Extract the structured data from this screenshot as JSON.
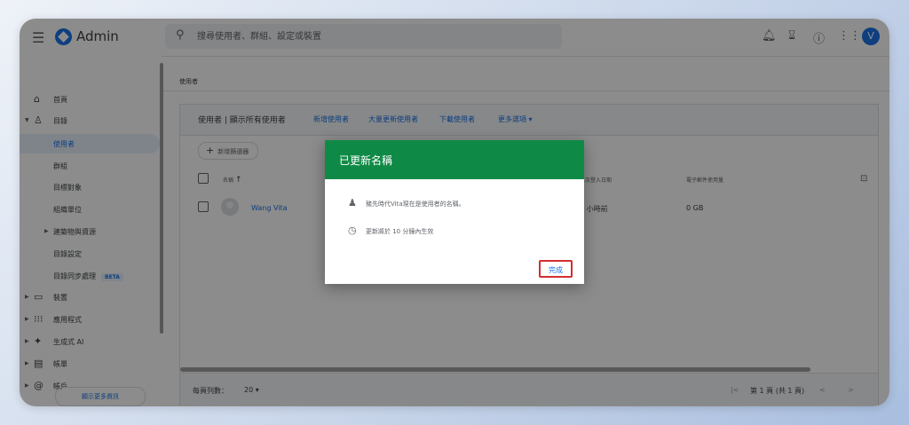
{
  "header": {
    "brand": "Admin",
    "search_placeholder": "搜尋使用者、群組、設定或裝置",
    "avatar_letter": "V"
  },
  "sidebar": {
    "items": [
      {
        "label": "首頁"
      },
      {
        "label": "目錄"
      },
      {
        "label": "使用者"
      },
      {
        "label": "群組"
      },
      {
        "label": "目標對象"
      },
      {
        "label": "組織單位"
      },
      {
        "label": "建築物與資源"
      },
      {
        "label": "目錄設定"
      },
      {
        "label": "目錄同步處理",
        "badge": "BETA"
      },
      {
        "label": "裝置"
      },
      {
        "label": "應用程式"
      },
      {
        "label": "生成式 AI"
      },
      {
        "label": "帳單"
      },
      {
        "label": "帳戶"
      }
    ],
    "more_button": "顯示更多資訊"
  },
  "main": {
    "breadcrumb": "使用者",
    "card_title": "使用者 | 顯示所有使用者",
    "actions": [
      "新增使用者",
      "大量更新使用者",
      "下載使用者",
      "更多選項"
    ],
    "add_filter": "新增篩選器",
    "columns": {
      "name": "名稱",
      "last_login": "上次登入日期",
      "email_usage": "電子郵件使用量"
    },
    "row": {
      "name": "Wang Vita",
      "last_login": "1 小時前",
      "email_usage": "0 GB"
    },
    "footer": {
      "rows_per_page_label": "每頁列數：",
      "rows_per_page_value": "20",
      "page_info": "第 1 頁 (共 1 頁)"
    }
  },
  "dialog": {
    "title": "已更新名稱",
    "line1": "豬先時代Vita現在是使用者的名稱。",
    "line2": "更新將於 10 分鐘內生效",
    "done_button": "完成"
  }
}
